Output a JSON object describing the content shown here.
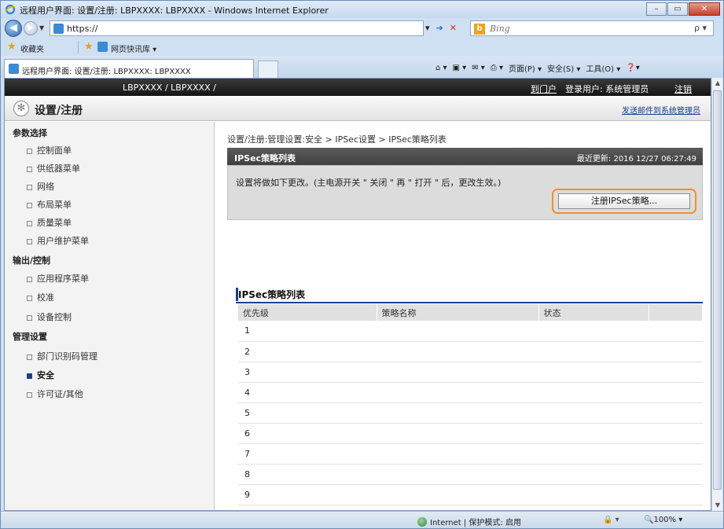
{
  "window": {
    "title": "远程用户界面: 设置/注册: LBPXXXX: LBPXXXX - Windows Internet Explorer",
    "min": "–",
    "max": "▭",
    "close": "✕"
  },
  "address": {
    "url": "https://",
    "search_placeholder": "Bing",
    "dropdown": "▾",
    "go": "➔",
    "stop": "✕",
    "search_mag": "ρ ▾"
  },
  "favorites": {
    "label": "收藏夹",
    "slice": "网页快讯库 ▾"
  },
  "tab": {
    "title": "远程用户界面: 设置/注册: LBPXXXX: LBPXXXX"
  },
  "commandbar": {
    "items": [
      "⌂ ▾",
      "▣ ▾",
      "✉ ▾",
      "⎙ ▾",
      "页面(P) ▾",
      "安全(S) ▾",
      "工具(O) ▾",
      "❓▾"
    ]
  },
  "page": {
    "device": "LBPXXXX / LBPXXXX /",
    "portal": "到门户",
    "login_user": "登录用户: 系统管理员",
    "logout": "注销",
    "title": "设置/注册",
    "mail_link": "发送邮件到系统管理员",
    "sidebar": {
      "categories": [
        {
          "label": "参数选择",
          "items": [
            "控制面单",
            "供纸器菜单",
            "网络",
            "布局菜单",
            "质量菜单",
            "用户维护菜单"
          ]
        },
        {
          "label": "输出/控制",
          "items": [
            "应用程序菜单",
            "校准",
            "设备控制"
          ]
        },
        {
          "label": "管理设置",
          "items": [
            "部门识别码管理",
            "安全",
            "许可证/其他"
          ]
        }
      ]
    },
    "breadcrumb": "设置/注册:管理设置:安全 > IPSec设置 > IPSec策略列表",
    "infobox": {
      "title": "IPSec策略列表",
      "updated": "最近更新: 2016 12/27 06:27:49",
      "message": "设置将做如下更改。(主电源开关 \" 关闭 \" 再 \" 打开 \" 后，更改生效。)",
      "register_button": "注册IPSec策略..."
    },
    "section_title": "IPSec策略列表",
    "table": {
      "headers": [
        "优先级",
        "策略名称",
        "状态",
        ""
      ],
      "rows": [
        "1",
        "2",
        "3",
        "4",
        "5",
        "6",
        "7",
        "8",
        "9"
      ]
    }
  },
  "statusbar": {
    "zone": "Internet | 保护模式: 启用",
    "tools": "🔒 ▾",
    "zoom": "🔍100% ▾"
  },
  "colors": {
    "accent": "#f4921f",
    "header_dark": "#1e1e1e",
    "link": "#1a3e8c"
  }
}
